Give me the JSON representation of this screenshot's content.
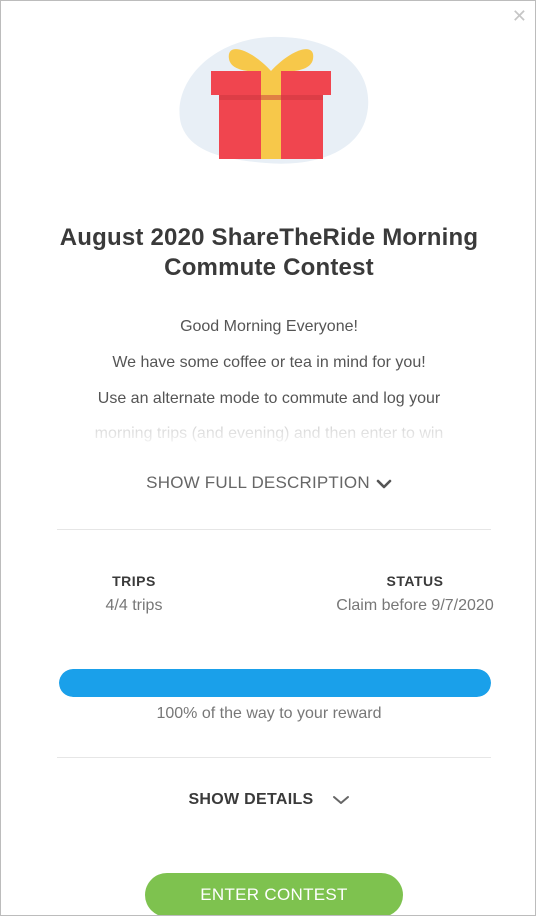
{
  "close_icon": "close-icon",
  "hero_icon": "gift-icon",
  "colors": {
    "gift_red": "#f0454f",
    "gift_ribbon": "#f7c84a",
    "blob": "#e8eff6",
    "progress": "#1aa0ea",
    "button": "#7ec24f"
  },
  "contest": {
    "title": "August 2020 ShareTheRide Morning Commute Contest",
    "description": [
      "Good Morning Everyone!",
      "We have some coffee or tea in mind for you!",
      "Use an alternate mode to commute and log your",
      "morning trips (and evening) and then enter to win"
    ],
    "show_full_label": "SHOW FULL DESCRIPTION"
  },
  "stats": {
    "trips_label": "TRIPS",
    "trips_value": "4/4 trips",
    "status_label": "STATUS",
    "status_value": "Claim before 9/7/2020"
  },
  "progress": {
    "percent": 100,
    "text": "100% of the way to your reward"
  },
  "details": {
    "label": "SHOW DETAILS"
  },
  "actions": {
    "enter_label": "ENTER CONTEST"
  }
}
